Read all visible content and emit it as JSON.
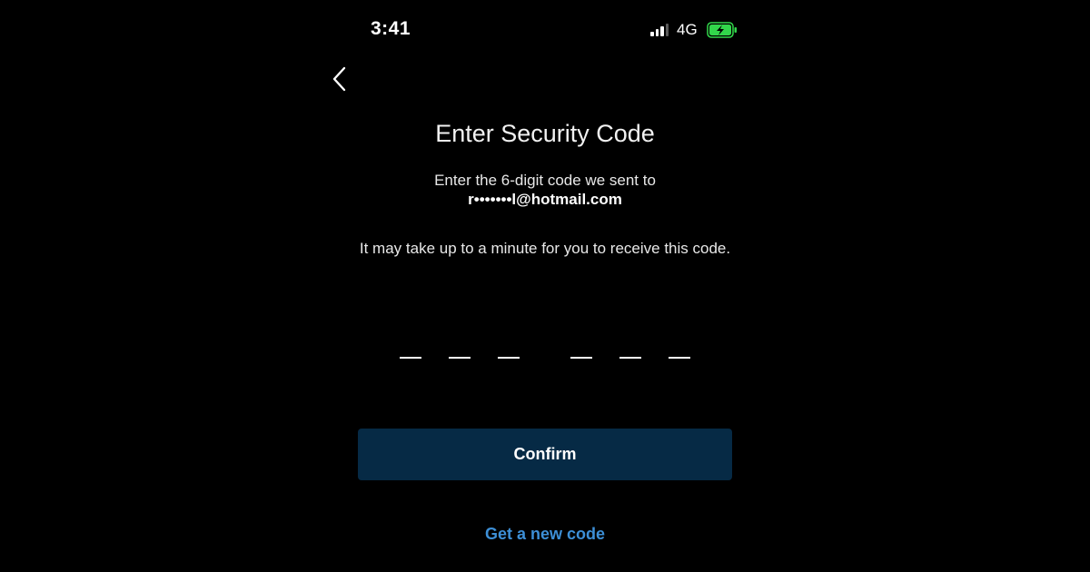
{
  "status_bar": {
    "time": "3:41",
    "network": "4G",
    "signal_icon": "cellular-signal-icon",
    "battery_icon": "battery-charging-icon",
    "battery_color": "#32d74b"
  },
  "nav": {
    "back_icon": "chevron-left-icon"
  },
  "screen": {
    "title": "Enter Security Code",
    "instruction": "Enter the 6-digit code we sent to",
    "email": "r•••••••l@hotmail.com",
    "wait_note": "It may take up to a minute for you to receive this code.",
    "code_input": {
      "digits": 6,
      "value": ""
    },
    "confirm_label": "Confirm",
    "new_code_label": "Get a new code"
  },
  "colors": {
    "background": "#000000",
    "button_bg": "#062a45",
    "link": "#3d8fd6"
  }
}
